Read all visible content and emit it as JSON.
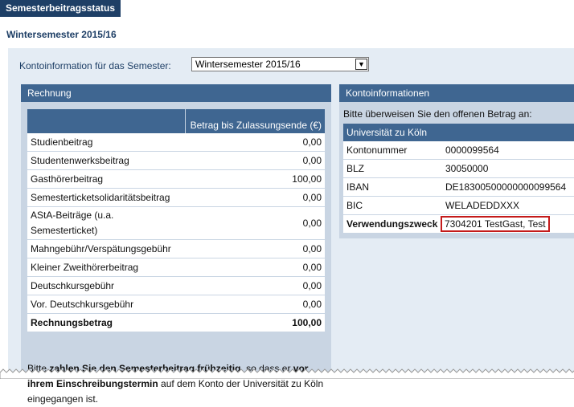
{
  "page": {
    "title": "Semesterbeitragsstatus"
  },
  "semester_heading": "Wintersemester 2015/16",
  "semester_select": {
    "label": "Kontoinformation für das Semester:",
    "value": "Wintersemester 2015/16"
  },
  "rechnung": {
    "title": "Rechnung",
    "column_header": "Betrag bis Zulassungsende (€)",
    "rows": [
      {
        "label": "Studienbeitrag",
        "amount": "0,00"
      },
      {
        "label": "Studentenwerksbeitrag",
        "amount": "0,00"
      },
      {
        "label": "Gasthörerbeitrag",
        "amount": "100,00"
      },
      {
        "label": "Semesterticketsolidaritätsbeitrag",
        "amount": "0,00"
      },
      {
        "label": "AStA-Beiträge (u.a. Semesterticket)",
        "amount": "0,00"
      },
      {
        "label": "Mahngebühr/Verspätungsgebühr",
        "amount": "0,00"
      },
      {
        "label": "Kleiner Zweithörerbeitrag",
        "amount": "0,00"
      },
      {
        "label": "Deutschkursgebühr",
        "amount": "0,00"
      },
      {
        "label": "Vor. Deutschkursgebühr",
        "amount": "0,00"
      }
    ],
    "total": {
      "label": "Rechnungsbetrag",
      "amount": "100,00"
    },
    "note": {
      "part1": "Bitte ",
      "bold1": "zahlen Sie den Semesterbeitrag frühzeitig",
      "part2": ", so dass er ",
      "bold2": "vor ihrem Einschreibungstermin",
      "part3": " auf dem Konto der Universität zu Köln eingegangen ist."
    }
  },
  "konto": {
    "title": "Kontoinformationen",
    "instruction": "Bitte überweisen Sie den offenen Betrag an:",
    "bank_name": "Universität zu Köln",
    "rows": [
      {
        "key": "Kontonummer",
        "value": "0000099564"
      },
      {
        "key": "BLZ",
        "value": "30050000"
      },
      {
        "key": "IBAN",
        "value": "DE18300500000000099564"
      },
      {
        "key": "BIC",
        "value": "WELADEDDXXX"
      }
    ],
    "verwendungszweck": {
      "key": "Verwendungszweck",
      "value": "7304201  TestGast, Test"
    }
  },
  "colors": {
    "header": "#1e3f66",
    "panel_head": "#3f6691",
    "panel_bg": "#c9d5e3",
    "outer_bg": "#e4ecf4",
    "highlight": "#c41a1a"
  }
}
